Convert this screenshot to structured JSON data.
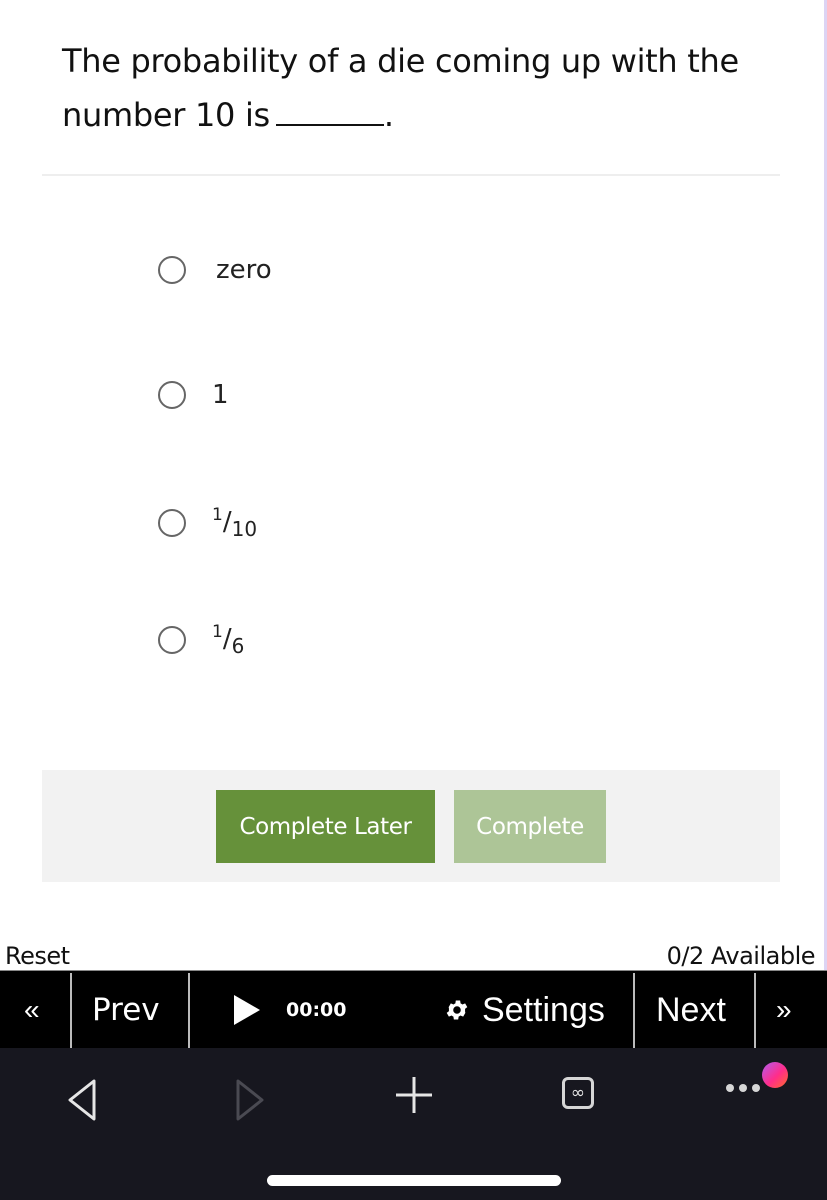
{
  "question": {
    "text": "The probability of a die coming up with the number 10 is",
    "suffix": "."
  },
  "options": [
    {
      "label": "zero",
      "type": "text"
    },
    {
      "label": "1",
      "type": "text"
    },
    {
      "numerator": "1",
      "slash": "/",
      "denominator": "10",
      "type": "fraction"
    },
    {
      "numerator": "1",
      "slash": "/",
      "denominator": "6",
      "type": "fraction"
    }
  ],
  "buttons": {
    "complete_later": "Complete Later",
    "complete": "Complete"
  },
  "status": {
    "reset": "Reset",
    "available": "0/2 Available"
  },
  "toolbar": {
    "first_icon": "«",
    "prev": "Prev",
    "timer": "00:00",
    "settings": "Settings",
    "next": "Next",
    "last_icon": "»"
  },
  "colors": {
    "primary_button": "#66913a",
    "disabled_button": "#adc597",
    "toolbar_bg": "#000000",
    "system_bar_bg": "#17171f"
  },
  "browser_bar": {
    "icons": [
      "back-icon",
      "forward-icon",
      "new-tab-icon",
      "tabs-icon",
      "more-icon"
    ],
    "tabs_glyph": "∞"
  }
}
